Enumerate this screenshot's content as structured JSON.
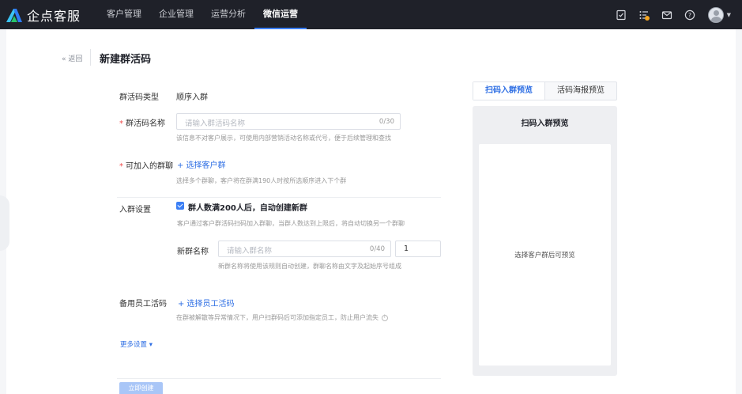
{
  "header": {
    "brand": "企点客服",
    "nav": [
      {
        "label": "客户管理",
        "active": false
      },
      {
        "label": "企业管理",
        "active": false
      },
      {
        "label": "运营分析",
        "active": false
      },
      {
        "label": "微信运营",
        "active": true
      }
    ],
    "icons": [
      "todo-icon",
      "task-list-icon",
      "mail-icon",
      "help-icon"
    ],
    "accent_color": "#3b7ff5",
    "badge_color": "#f5a623"
  },
  "page": {
    "back_label": "« 返回",
    "title": "新建群活码"
  },
  "form": {
    "type_label": "群活码类型",
    "type_value": "顺序入群",
    "name_label": "群活码名称",
    "name_placeholder": "请输入群活码名称",
    "name_counter": "0/30",
    "name_hint": "该信息不对客户展示，可使用内部营销活动名称或代号，便于后续管理和查找",
    "groups_label": "可加入的群聊",
    "groups_link": "+ 选择客户群",
    "groups_hint": "选择多个群聊，客户将在群满190人时按所选顺序进入下个群",
    "join_label": "入群设置",
    "auto_create_label": "群人数满200人后，自动创建新群",
    "auto_create_hint": "客户通过客户群活码扫码加入群聊，当群人数达到上限后，将自动切换另一个群聊",
    "new_group_label": "新群名称",
    "new_group_placeholder": "请输入群名称",
    "new_group_counter": "0/40",
    "new_group_seq": "1",
    "new_group_hint": "新群名称将使用该规则自动创建，群聊名称由文字及起始序号组成",
    "backup_label": "备用员工活码",
    "backup_link": "+ 选择员工活码",
    "backup_hint": "在群被解散等异常情况下，用户扫群码后可添加指定员工，防止用户流失",
    "more_label": "更多设置 ▾",
    "create_button": "立即创建"
  },
  "preview": {
    "tabs": [
      "扫码入群预览",
      "活码海报预览"
    ],
    "title": "扫码入群预览",
    "empty_text": "选择客户群后可预览"
  }
}
